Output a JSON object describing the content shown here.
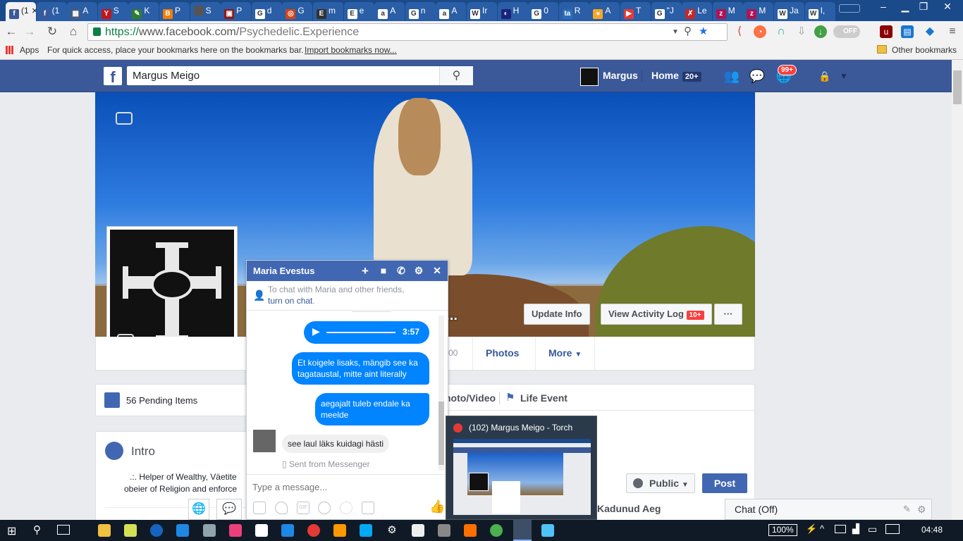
{
  "browser": {
    "tabs": [
      {
        "label": "(1",
        "color": "#3b5998",
        "glyph": "f",
        "active": true
      },
      {
        "label": "(1",
        "color": "#3b5998",
        "glyph": "f"
      },
      {
        "label": "A",
        "color": "#4a5a7a",
        "glyph": "▦"
      },
      {
        "label": "S",
        "color": "#c4151c",
        "glyph": "Y"
      },
      {
        "label": "K",
        "color": "#2e7d32",
        "glyph": "✎"
      },
      {
        "label": "P",
        "color": "#f57c00",
        "glyph": "B"
      },
      {
        "label": "S",
        "color": "#555555",
        "glyph": ""
      },
      {
        "label": "P",
        "color": "#8b1a1a",
        "glyph": "▣"
      },
      {
        "label": "d",
        "color": "#ffffff",
        "glyph": "G"
      },
      {
        "label": "G",
        "color": "#d84315",
        "glyph": "◎"
      },
      {
        "label": "m",
        "color": "#333333",
        "glyph": "E"
      },
      {
        "label": "e",
        "color": "#ffffff",
        "glyph": "E"
      },
      {
        "label": "A",
        "color": "#ffffff",
        "glyph": "a"
      },
      {
        "label": "n",
        "color": "#ffffff",
        "glyph": "G"
      },
      {
        "label": "A",
        "color": "#ffffff",
        "glyph": "a"
      },
      {
        "label": "Ir",
        "color": "#ffffff",
        "glyph": "W"
      },
      {
        "label": "H",
        "color": "#1a237e",
        "glyph": "◐"
      },
      {
        "label": "0",
        "color": "#ffffff",
        "glyph": "G"
      },
      {
        "label": "R",
        "color": "#2a6ebb",
        "glyph": "ta"
      },
      {
        "label": "A",
        "color": "#f9a825",
        "glyph": "●"
      },
      {
        "label": "T",
        "color": "#e53935",
        "glyph": "▶"
      },
      {
        "label": "\"J",
        "color": "#ffffff",
        "glyph": "G"
      },
      {
        "label": "Le",
        "color": "#c62828",
        "glyph": "✗"
      },
      {
        "label": "M",
        "color": "#ad1457",
        "glyph": "z"
      },
      {
        "label": "M",
        "color": "#ad1457",
        "glyph": "z"
      },
      {
        "label": "Ja",
        "color": "#ffffff",
        "glyph": "W"
      },
      {
        "label": "I,",
        "color": "#ffffff",
        "glyph": "W"
      }
    ],
    "url_scheme": "https://",
    "url_host": "www.facebook.com/",
    "url_path": "Psychedelic.Experience",
    "toggle_label": "OFF",
    "bookmarks_apps": "Apps",
    "bookmarks_hint": "For quick access, place your bookmarks here on the bookmarks bar.",
    "bookmarks_import": "Import bookmarks now...",
    "other_bookmarks": "Other bookmarks"
  },
  "facebook": {
    "search_value": "Margus Meigo",
    "user_name": "Margus",
    "home_label": "Home",
    "home_badge": "20+",
    "notif_badge": "99+",
    "cover_name": "d...",
    "update_info": "Update Info",
    "activity_log": "View Activity Log",
    "activity_badge": "10+",
    "more_dots": "···",
    "timeline_tabs": {
      "count_fragment": "00",
      "photos": "Photos",
      "more": "More"
    },
    "pending": "56 Pending Items",
    "composer_tabs": {
      "photo_video": "hoto/Video",
      "life_event": "Life Event"
    },
    "public_label": "Public",
    "post_label": "Post",
    "intro_title": "Intro",
    "intro_text_1": ".:. Helper of Wealthy, Väetite",
    "intro_text_2": "obeier of Religion and enforce",
    "kadunud": "Kadunud Aeg",
    "chat_off": "Chat (Off)"
  },
  "chat": {
    "name": "Maria Evestus",
    "notice": "To chat with Maria and other friends,",
    "notice_link": "turn on chat",
    "audio_duration": "3:57",
    "messages": [
      "Et koigele lisaks, mängib see ka tagataustal, mitte aint literally",
      "aegajalt tuleb endale ka meelde"
    ],
    "received": "see laul läks kuidagi hästi",
    "sent_from": "Sent from Messenger",
    "placeholder": "Type a message..."
  },
  "preview": {
    "title": "(102) Margus Meigo - Torch"
  },
  "taskbar": {
    "battery": "100%",
    "clock": "04:48",
    "colors": {
      "accent": "#1b6ac9"
    }
  }
}
